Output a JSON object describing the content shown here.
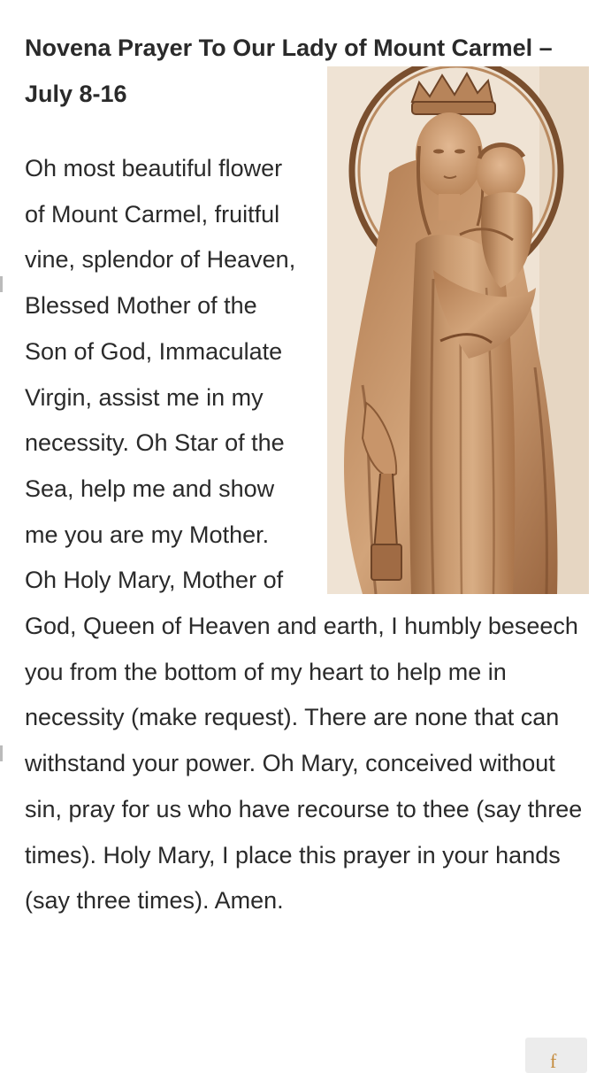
{
  "article": {
    "title": "Novena Prayer To Our Lady of Mount Carmel – July 8-16",
    "prayer": "Oh most beautiful flower of Mount Carmel, fruitful vine, splendor of Heaven, Blessed Mother of the Son of God, Immaculate Virgin, assist me in my necessity. Oh Star of the Sea, help me and show me you are my Mother. Oh Holy Mary, Mother of God, Queen of Heaven and earth, I humbly beseech you from the bottom of my heart to help me in necessity (make request). There are none that can withstand your power. Oh Mary, conceived without sin, pray for us who have recourse to thee (say three times). Holy Mary, I place this prayer in your hands (say three times). Amen."
  },
  "figure": {
    "icon": "carved-wooden-statue-madonna-and-child",
    "colors": {
      "wood": "#c8956a",
      "wood_dark": "#8a5a36",
      "wall": "#efe4d6"
    }
  },
  "corner_badge": {
    "glyph": "f",
    "color": "#c48a3a"
  }
}
